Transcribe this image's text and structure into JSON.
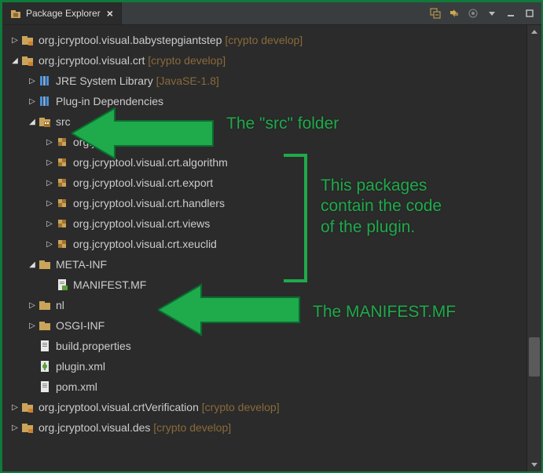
{
  "view": {
    "title": "Package Explorer"
  },
  "toolbar": {
    "collapse": "collapse-all",
    "link": "link-with-editor",
    "focus": "focus-on-active-task",
    "viewmenu": "view-menu",
    "min": "minimize",
    "max": "maximize"
  },
  "annotations": {
    "src": "The \"src\" folder",
    "packages": "This packages\ncontain the code\nof the plugin.",
    "manifest": "The MANIFEST.MF"
  },
  "tree": [
    {
      "id": "p0",
      "indent": 0,
      "twisty": "closed",
      "icon": "project",
      "label": "org.jcryptool.visual.babystepgiantstep",
      "suffix": " [crypto develop]"
    },
    {
      "id": "p1",
      "indent": 0,
      "twisty": "open",
      "icon": "project",
      "label": "org.jcryptool.visual.crt",
      "suffix": " [crypto develop]"
    },
    {
      "id": "jre",
      "indent": 1,
      "twisty": "closed",
      "icon": "library",
      "label": "JRE System Library",
      "suffix": " [JavaSE-1.8]"
    },
    {
      "id": "pid",
      "indent": 1,
      "twisty": "closed",
      "icon": "library",
      "label": "Plug-in Dependencies",
      "suffix": ""
    },
    {
      "id": "src",
      "indent": 1,
      "twisty": "open",
      "icon": "srcfolder",
      "label": "src",
      "suffix": ""
    },
    {
      "id": "pk0",
      "indent": 2,
      "twisty": "closed",
      "icon": "package",
      "label": "org.jcryptool.visual.crt",
      "suffix": ""
    },
    {
      "id": "pk1",
      "indent": 2,
      "twisty": "closed",
      "icon": "package",
      "label": "org.jcryptool.visual.crt.algorithm",
      "suffix": ""
    },
    {
      "id": "pk2",
      "indent": 2,
      "twisty": "closed",
      "icon": "package",
      "label": "org.jcryptool.visual.crt.export",
      "suffix": ""
    },
    {
      "id": "pk3",
      "indent": 2,
      "twisty": "closed",
      "icon": "package",
      "label": "org.jcryptool.visual.crt.handlers",
      "suffix": ""
    },
    {
      "id": "pk4",
      "indent": 2,
      "twisty": "closed",
      "icon": "package",
      "label": "org.jcryptool.visual.crt.views",
      "suffix": ""
    },
    {
      "id": "pk5",
      "indent": 2,
      "twisty": "closed",
      "icon": "package",
      "label": "org.jcryptool.visual.crt.xeuclid",
      "suffix": ""
    },
    {
      "id": "mi",
      "indent": 1,
      "twisty": "open",
      "icon": "folder",
      "label": "META-INF",
      "suffix": ""
    },
    {
      "id": "mf",
      "indent": 2,
      "twisty": "none",
      "icon": "manifest",
      "label": "MANIFEST.MF",
      "suffix": ""
    },
    {
      "id": "nl",
      "indent": 1,
      "twisty": "closed",
      "icon": "folder",
      "label": "nl",
      "suffix": ""
    },
    {
      "id": "os",
      "indent": 1,
      "twisty": "closed",
      "icon": "folder",
      "label": "OSGI-INF",
      "suffix": ""
    },
    {
      "id": "bp",
      "indent": 1,
      "twisty": "none",
      "icon": "file",
      "label": "build.properties",
      "suffix": ""
    },
    {
      "id": "px",
      "indent": 1,
      "twisty": "none",
      "icon": "pluginxml",
      "label": "plugin.xml",
      "suffix": ""
    },
    {
      "id": "pom",
      "indent": 1,
      "twisty": "none",
      "icon": "file",
      "label": "pom.xml",
      "suffix": ""
    },
    {
      "id": "p2",
      "indent": 0,
      "twisty": "closed",
      "icon": "project",
      "label": "org.jcryptool.visual.crtVerification",
      "suffix": " [crypto develop]"
    },
    {
      "id": "p3",
      "indent": 0,
      "twisty": "closed",
      "icon": "project",
      "label": "org.jcryptool.visual.des",
      "suffix": " [crypto develop]"
    }
  ]
}
